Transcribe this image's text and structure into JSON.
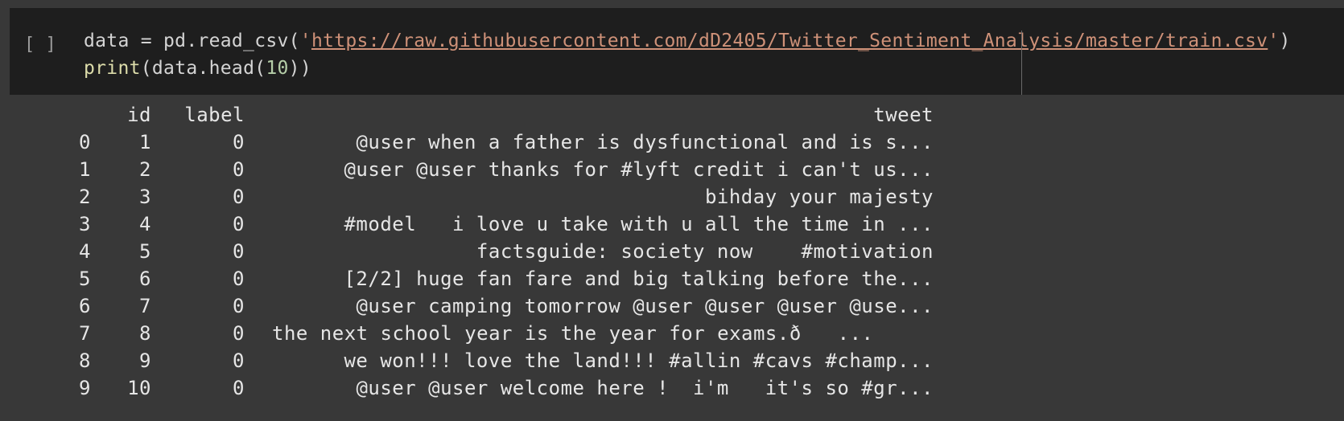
{
  "cell": {
    "run_indicator": "[ ]",
    "code_line1_prefix": "data = pd.read_csv(",
    "code_line1_quote_open": "'",
    "code_line1_url": "https://raw.githubusercontent.com/dD2405/Twitter_Sentiment_Analysis/master/train.csv",
    "code_line1_quote_close": "'",
    "code_line1_suffix": ")",
    "code_line2_fn": "print",
    "code_line2_mid": "(data.head(",
    "code_line2_num": "10",
    "code_line2_end": "))"
  },
  "output": {
    "header": {
      "id": "id",
      "label": "label",
      "tweet": "tweet"
    },
    "rows": [
      {
        "idx": "0",
        "id": "1",
        "label": "0",
        "tweet": "@user when a father is dysfunctional and is s..."
      },
      {
        "idx": "1",
        "id": "2",
        "label": "0",
        "tweet": "@user @user thanks for #lyft credit i can't us..."
      },
      {
        "idx": "2",
        "id": "3",
        "label": "0",
        "tweet": "bihday your majesty"
      },
      {
        "idx": "3",
        "id": "4",
        "label": "0",
        "tweet": "#model   i love u take with u all the time in ..."
      },
      {
        "idx": "4",
        "id": "5",
        "label": "0",
        "tweet": "factsguide: society now    #motivation"
      },
      {
        "idx": "5",
        "id": "6",
        "label": "0",
        "tweet": "[2/2] huge fan fare and big talking before the..."
      },
      {
        "idx": "6",
        "id": "7",
        "label": "0",
        "tweet": "@user camping tomorrow @user @user @user @use..."
      },
      {
        "idx": "7",
        "id": "8",
        "label": "0",
        "tweet": "the next school year is the year for exams.ð   ..."
      },
      {
        "idx": "8",
        "id": "9",
        "label": "0",
        "tweet": "we won!!! love the land!!! #allin #cavs #champ..."
      },
      {
        "idx": "9",
        "id": "10",
        "label": "0",
        "tweet": "@user @user welcome here !  i'm   it's so #gr..."
      }
    ]
  }
}
